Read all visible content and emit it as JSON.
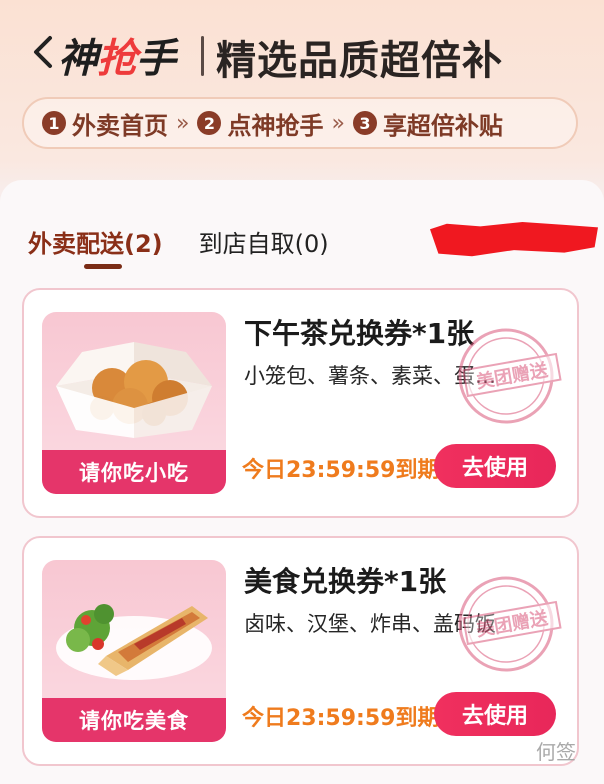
{
  "header": {
    "back_icon": "chevron-left-icon",
    "brand_dark": "神",
    "brand_accent": "抢",
    "brand_dark2": "手",
    "slogan": "精选品质超倍补"
  },
  "steps": [
    {
      "num": "1",
      "label": "外卖首页"
    },
    {
      "num": "2",
      "label": "点神抢手"
    },
    {
      "num": "3",
      "label": "享超倍补贴"
    }
  ],
  "step_separator": "»",
  "tabs": [
    {
      "label": "外卖配送(2)",
      "active": true
    },
    {
      "label": "到店自取(0)",
      "active": false
    }
  ],
  "vouchers": [
    {
      "thumb_label": "请你吃小吃",
      "title": "下午茶兑换券*1张",
      "desc": "小笼包、薯条、素菜、蛋…",
      "stamp": "美团赠送",
      "expire": "今日23:59:59到期",
      "button": "去使用"
    },
    {
      "thumb_label": "请你吃美食",
      "title": "美食兑换券*1张",
      "desc": "卤味、汉堡、炸串、盖码饭",
      "stamp": "美团赠送",
      "expire": "今日23:59:59到期",
      "button": "去使用"
    }
  ],
  "watermark": "何签",
  "colors": {
    "accent": "#e5356a",
    "brand_red": "#ee3b3b",
    "expire_orange": "#ef7b1d",
    "step_brown": "#8a3c28"
  }
}
